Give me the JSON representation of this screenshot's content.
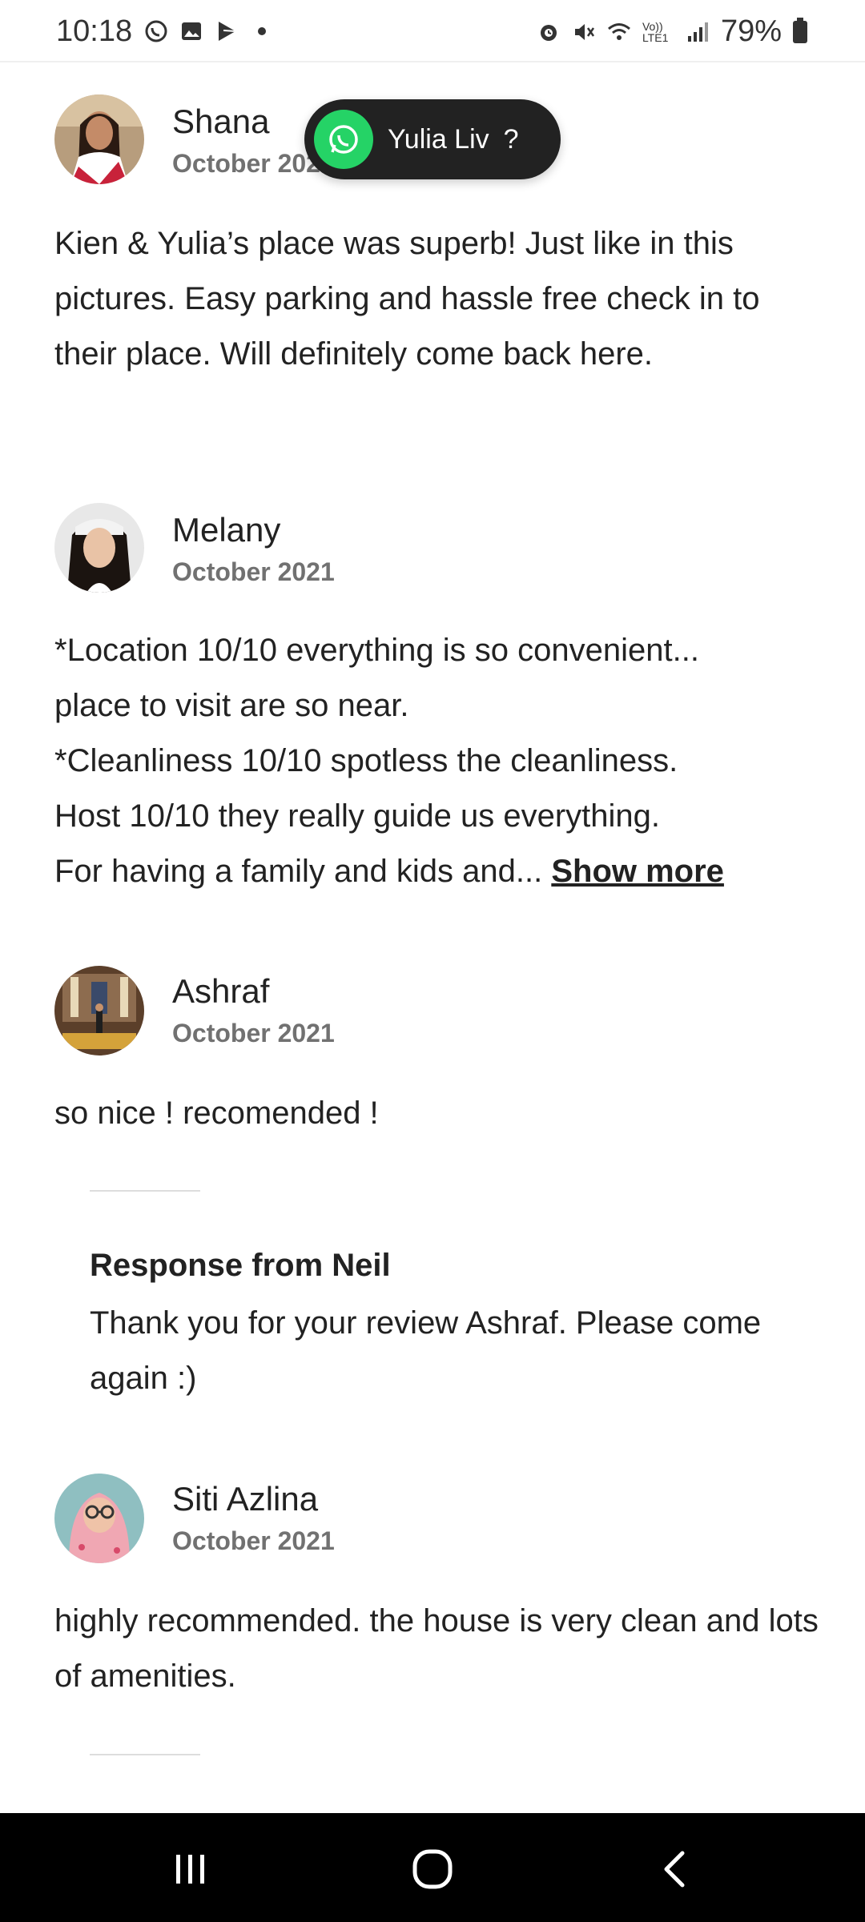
{
  "status_bar": {
    "time": "10:18",
    "battery": "79%",
    "left_icons": [
      "whatsapp-icon",
      "gallery-icon",
      "play-store-icon",
      "dot-icon"
    ],
    "right_icons": [
      "alarm-icon",
      "mute-icon",
      "wifi-icon",
      "volte-icon",
      "signal-icon",
      "battery-icon"
    ],
    "volte_label": "Vo)) LTE1"
  },
  "whatsapp_chip": {
    "label": "Yulia Liv",
    "help": "?",
    "icon": "whatsapp-icon",
    "accent": "#25d366"
  },
  "reviews": [
    {
      "name": "Shana",
      "date": "October 2021",
      "text": "Kien & Yulia’s place was superb! Just like in this pictures. Easy parking and hassle free check in to their place. Will definitely come back here."
    },
    {
      "name": "Melany",
      "date": "October 2021",
      "text_lines": [
        "*Location 10/10 everything is so convenient...",
        "place to visit are so near.",
        "*Cleanliness 10/10 spotless the cleanliness.",
        "Host 10/10 they really guide us everything.",
        "For having a family and kids and..."
      ],
      "show_more": "Show more"
    },
    {
      "name": "Ashraf",
      "date": "October 2021",
      "text": "so nice ! recomended !",
      "response": {
        "title": "Response from Neil",
        "text": "Thank you for your review Ashraf. Please come again :)"
      }
    },
    {
      "name": "Siti Azlina",
      "date": "October 2021",
      "text": "highly recommended. the house is very clean and lots of amenities."
    }
  ],
  "nav_bar": {
    "buttons": [
      "recent-apps-icon",
      "home-icon",
      "back-icon"
    ]
  }
}
